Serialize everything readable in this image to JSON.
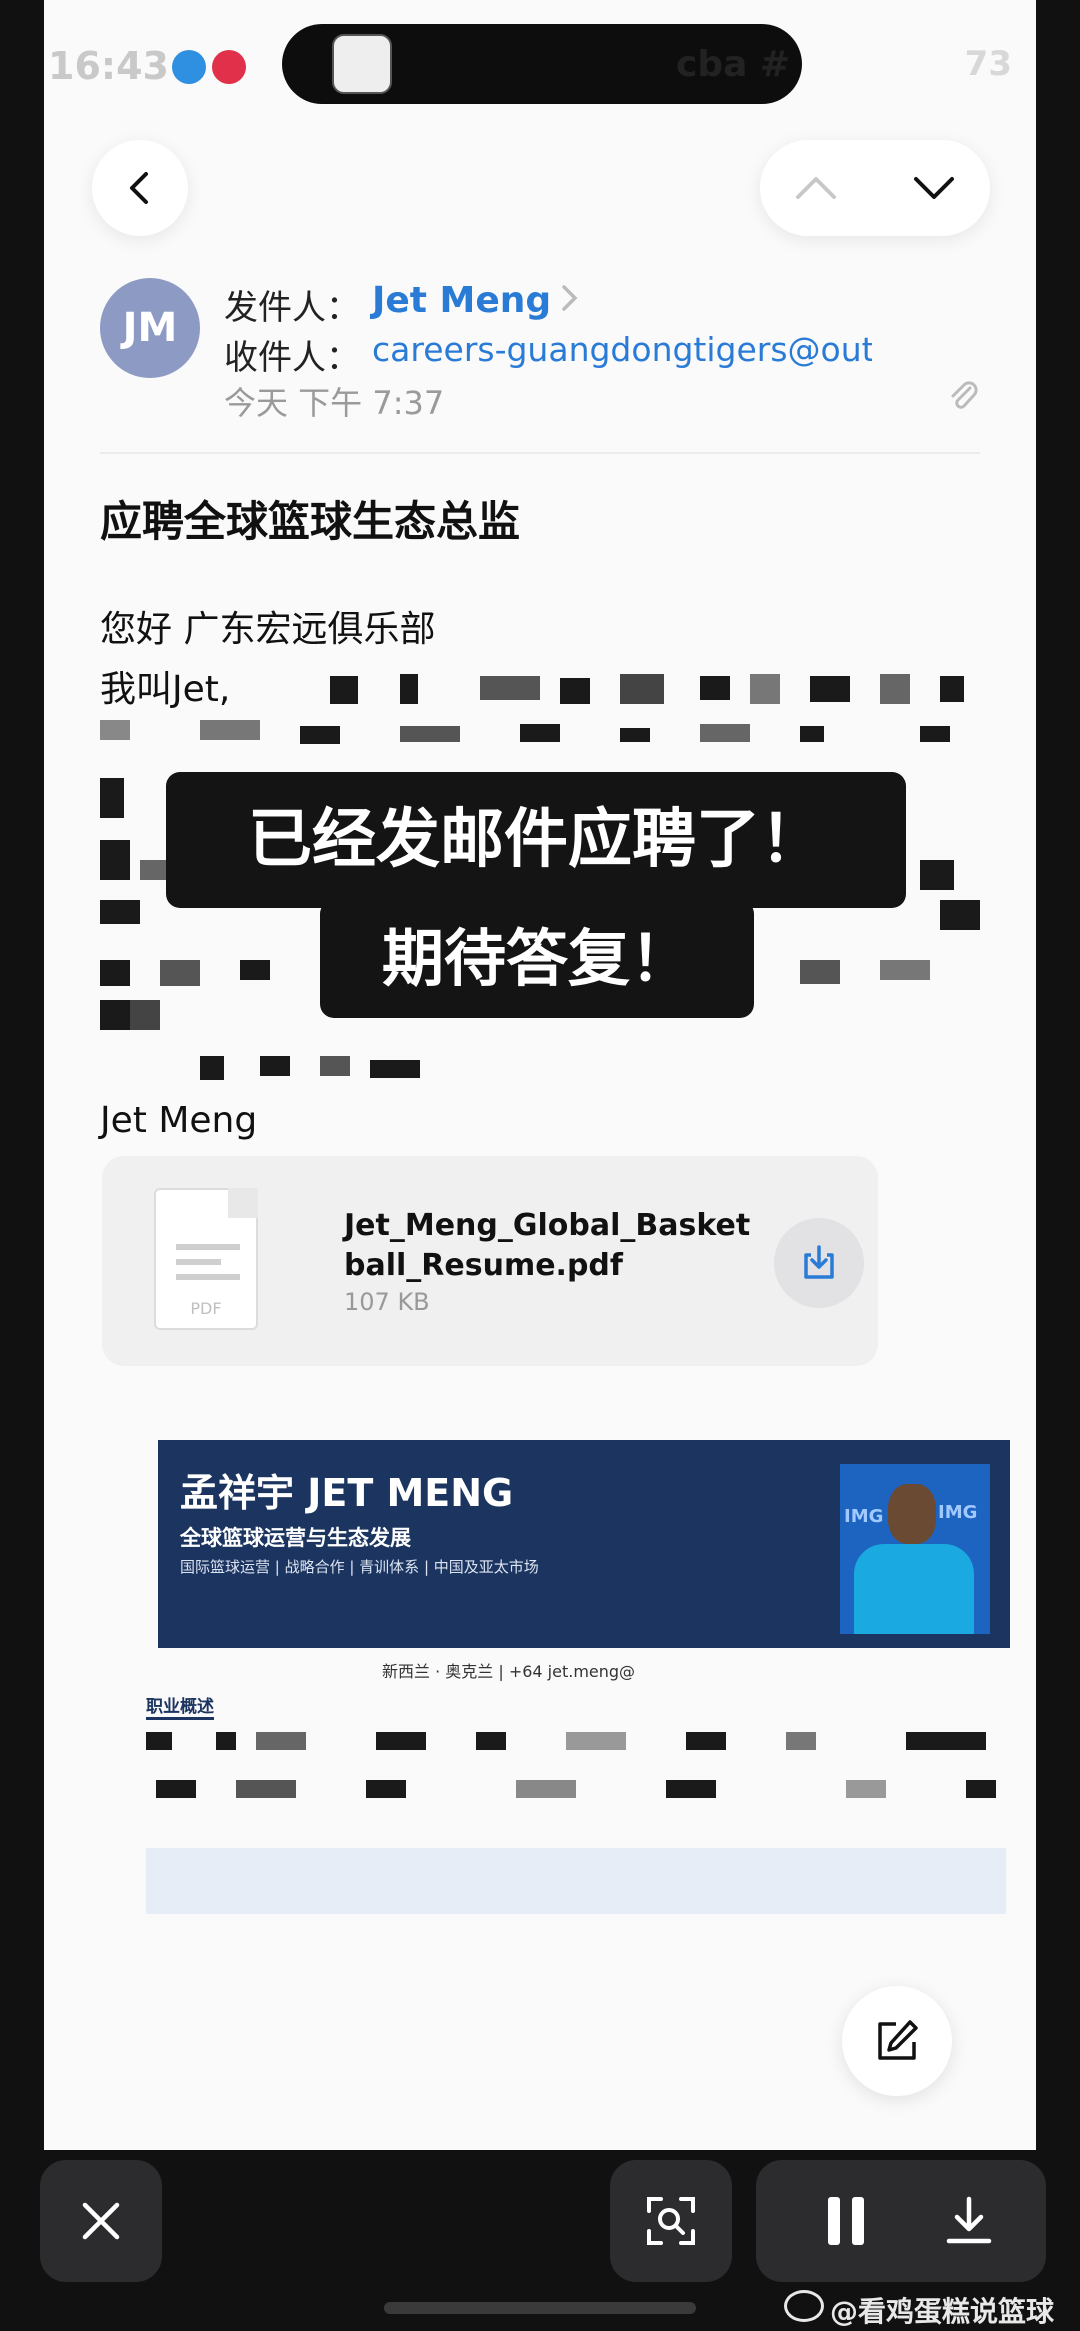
{
  "status_bar": {
    "time": "16:43",
    "center_text": "cba #",
    "battery": "73"
  },
  "email": {
    "from_label": "发件人：",
    "from_name": "Jet Meng",
    "to_label": "收件人：",
    "to_address": "careers-guangdongtigers@outloo",
    "date": "今天 下午 7:37",
    "subject": "应聘全球篮球生态总监",
    "greeting": "您好 广东宏远俱乐部",
    "intro": "我叫Jet,",
    "signature": "Jet Meng",
    "avatar_initials": "JM"
  },
  "overlay": {
    "line1": "已经发邮件应聘了！",
    "line2": "期待答复！"
  },
  "attachment": {
    "file_name": "Jet_Meng_Global_Basketball_Resume.pdf",
    "size": "107 KB",
    "icon_label": "PDF"
  },
  "resume_preview": {
    "name": "孟祥宇  JET MENG",
    "subtitle": "全球篮球运营与生态发展",
    "tags": "国际篮球运营 | 战略合作 | 青训体系 | 中国及亚太市场",
    "contact": "新西兰 · 奥克兰   |  +64                    jet.meng@",
    "section1": "职业概述",
    "photo_logo_left": "IMG",
    "photo_logo_right": "IMG"
  },
  "watermark": "@看鸡蛋糕说篮球",
  "colors": {
    "link": "#2a7bd6",
    "avatar": "#8d9bc4",
    "resume_banner": "#1c3560",
    "overlay_bg": "#141414"
  }
}
